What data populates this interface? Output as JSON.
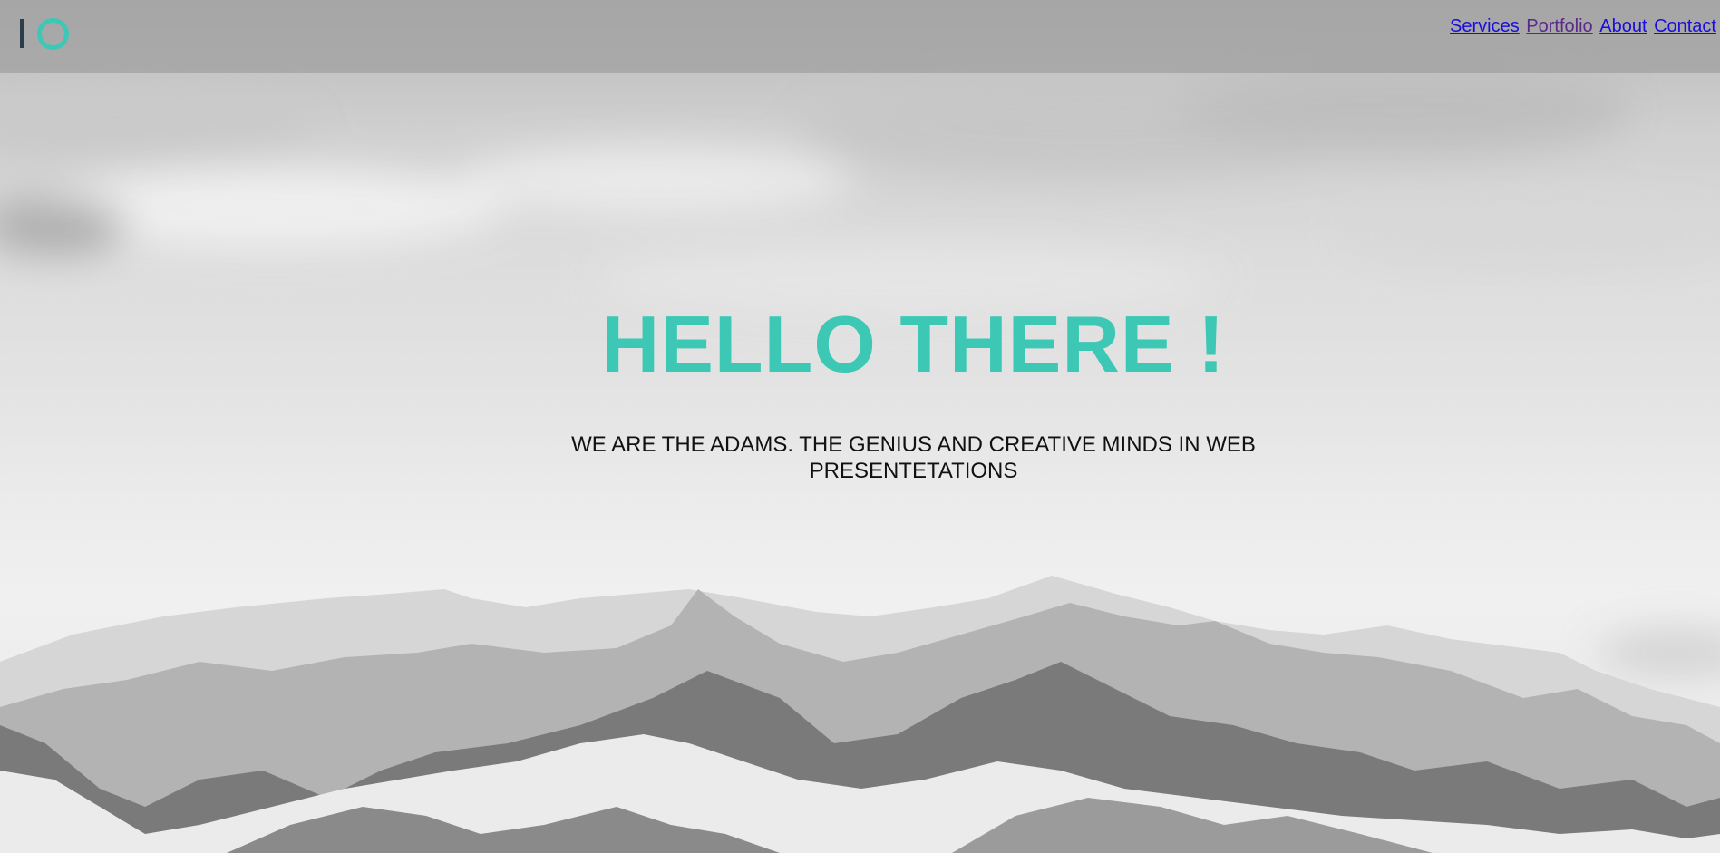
{
  "header": {
    "logo_name": "logo-icon",
    "nav": [
      {
        "label": "Services"
      },
      {
        "label": "Portfolio"
      },
      {
        "label": "About"
      },
      {
        "label": "Contact"
      }
    ]
  },
  "hero": {
    "title": "HELLO THERE !",
    "subtitle": "WE ARE THE ADAMS. THE GENIUS AND CREATIVE MINDS IN WEB PRESENTETATIONS"
  },
  "colors": {
    "accent": "#3cc8b4",
    "logo_dark": "#2d3e4a",
    "link": "#1a0dde",
    "link_visited": "#5a2a8a"
  }
}
